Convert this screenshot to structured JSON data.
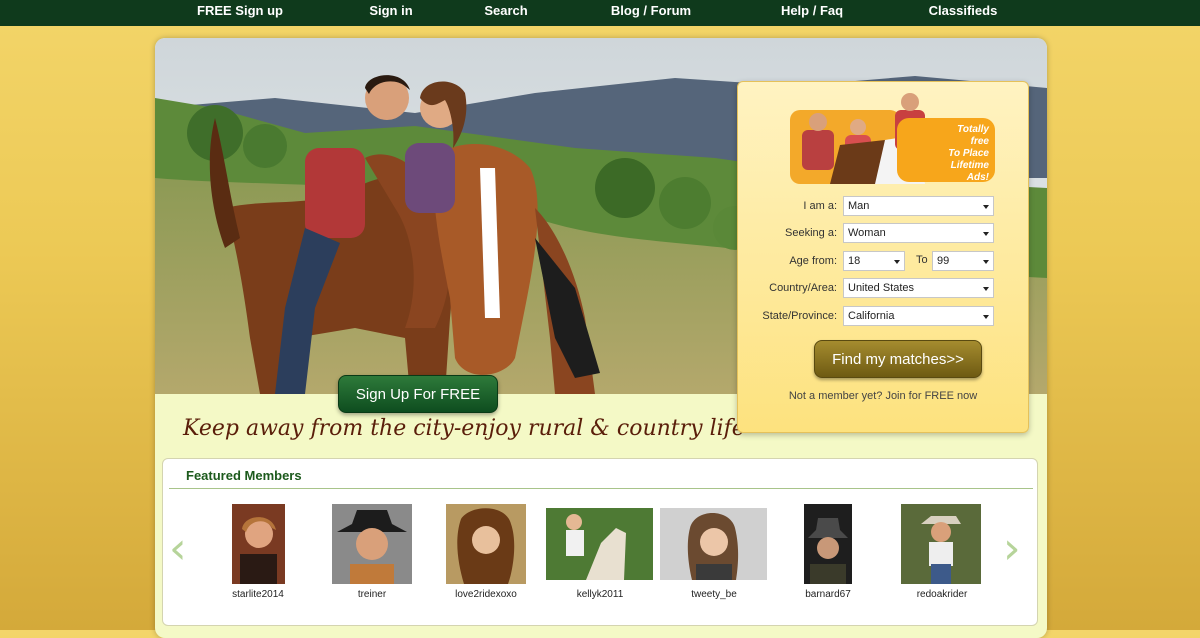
{
  "nav": {
    "items": [
      "FREE Sign up",
      "Sign in",
      "Search",
      "Blog / Forum",
      "Help / Faq",
      "Classifieds"
    ]
  },
  "hero": {
    "signup_button": "Sign Up For FREE",
    "tagline": "Keep away from the city-enjoy rural & country life"
  },
  "search": {
    "promo_lines": [
      "Totally",
      "free",
      "To Place",
      "Lifetime",
      "Ads!"
    ],
    "labels": {
      "i_am": "I am a:",
      "seeking": "Seeking a:",
      "age_from": "Age from:",
      "age_to": "To",
      "country": "Country/Area:",
      "state": "State/Province:"
    },
    "values": {
      "i_am": "Man",
      "seeking": "Woman",
      "age_from": "18",
      "age_to": "99",
      "country": "United States",
      "state": "California"
    },
    "submit_label": "Find my matches>>",
    "join_note": "Not a member yet? Join for FREE now"
  },
  "featured": {
    "title": "Featured Members",
    "prev_icon": "‹",
    "next_icon": "›",
    "members": [
      "starlite2014",
      "treiner",
      "love2ridexoxo",
      "kellyk2011",
      "tweety_be",
      "barnard67",
      "redoakrider"
    ]
  },
  "colors": {
    "nav_bg": "#0f3a1c",
    "page_bg": "#ecc955",
    "panel_bg": "#f4f9c6",
    "accent_green": "#1c5a1c",
    "tagline": "#5a1e0a"
  }
}
